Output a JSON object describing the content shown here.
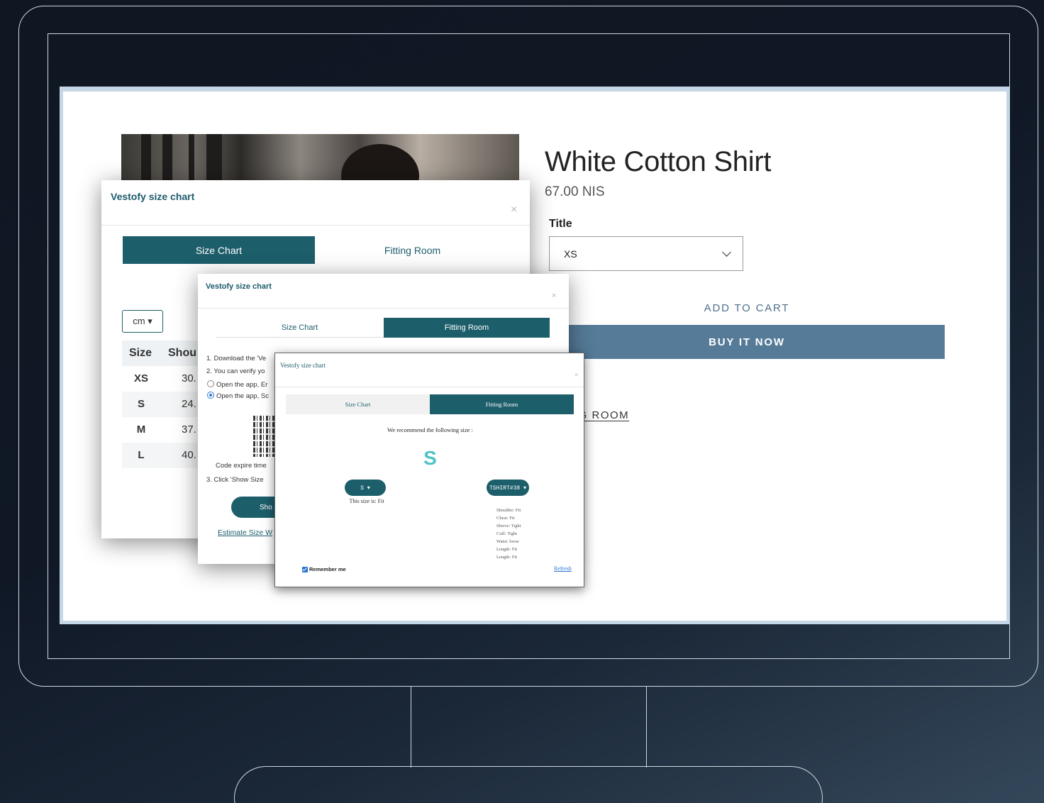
{
  "product": {
    "title": "White Cotton Shirt",
    "price": "67.00 NIS",
    "option_label": "Title",
    "option_value": "XS",
    "add_to_cart": "ADD TO CART",
    "buy_now": "BUY IT NOW",
    "fitting_link_visible": "NG ROOM"
  },
  "modal1": {
    "title": "Vestofy size chart",
    "close": "×",
    "tabs": [
      "Size Chart",
      "Fitting Room"
    ],
    "unit": "cm ▾",
    "headers": [
      "Size",
      "Shou"
    ],
    "rows": [
      {
        "size": "XS",
        "value": "30."
      },
      {
        "size": "S",
        "value": "24."
      },
      {
        "size": "M",
        "value": "37."
      },
      {
        "size": "L",
        "value": "40."
      }
    ]
  },
  "modal2": {
    "title": "Vestofy size chart",
    "close": "×",
    "tabs": [
      "Size Chart",
      "Fitting Room"
    ],
    "step1": "1. Download the 'Ve",
    "step2": "2. You can verify yo",
    "option_a": "Open the app, Er",
    "option_b": "Open the app, Sc",
    "code_expire": "Code expire time",
    "step3": "3. Click 'Show Size",
    "show_button": "Sho",
    "estimate_link": "Estimate Size W"
  },
  "modal3": {
    "title": "Vestofy size chart",
    "close": "×",
    "tabs": [
      "Size Chart",
      "Fitting Room"
    ],
    "recommend": "We recommend the following size :",
    "size": "S",
    "size_pill": "S ▾",
    "fit_text": "This size is: Fit",
    "garment_pill": "TSHIRT#38 ▾",
    "fit_list": [
      "Shoulder: Fit",
      "Chest: Fit",
      "Sleeve: Tight",
      "Cuff: Tight",
      "Waist: loose",
      "Length: Fit",
      "Length: Fit"
    ],
    "remember": "Remember me",
    "refresh": "Refresh"
  }
}
